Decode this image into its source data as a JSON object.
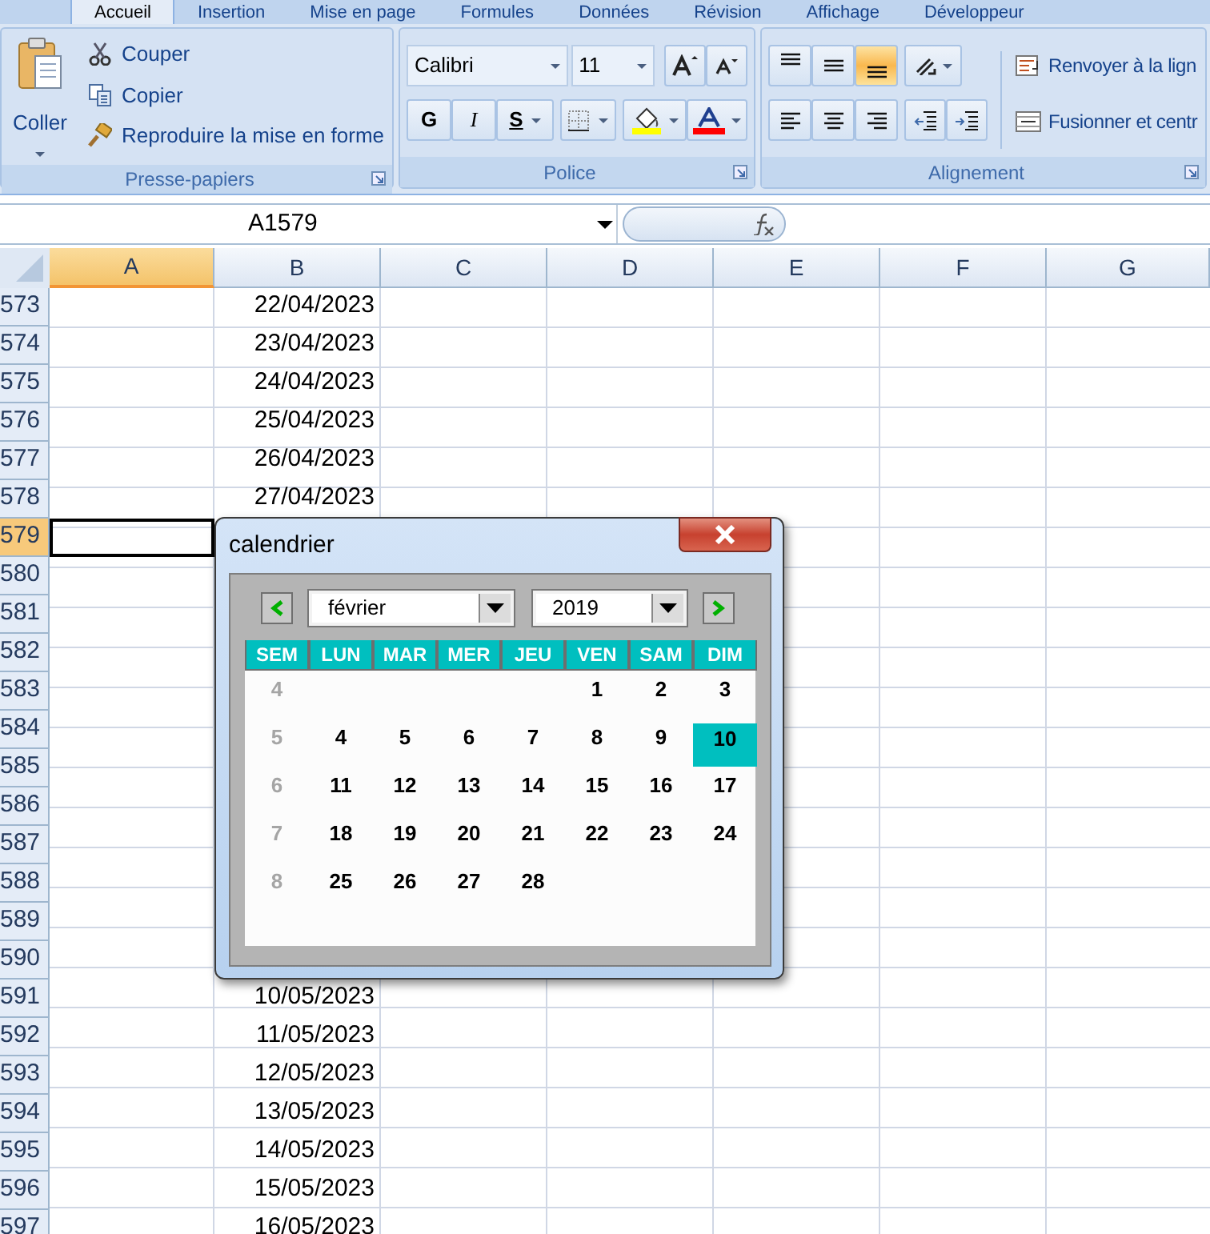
{
  "ribbon_tabs": [
    {
      "label": "Accueil",
      "selected": true
    },
    {
      "label": "Insertion",
      "selected": false
    },
    {
      "label": "Mise en page",
      "selected": false
    },
    {
      "label": "Formules",
      "selected": false
    },
    {
      "label": "Données",
      "selected": false
    },
    {
      "label": "Révision",
      "selected": false
    },
    {
      "label": "Affichage",
      "selected": false
    },
    {
      "label": "Développeur",
      "selected": false
    }
  ],
  "clipboard": {
    "paste": "Coller",
    "items": [
      {
        "kind": "cut",
        "label": "Couper"
      },
      {
        "kind": "copy",
        "label": "Copier"
      },
      {
        "kind": "format_painter",
        "label": "Reproduire la mise en forme"
      }
    ],
    "group_label": "Presse-papiers"
  },
  "font": {
    "name": "Calibri",
    "size": "11",
    "styles": [
      "G",
      "I",
      "S"
    ],
    "group_label": "Police"
  },
  "alignment": {
    "vertical": [
      {
        "kind": "top",
        "selected": false
      },
      {
        "kind": "middle",
        "selected": false
      },
      {
        "kind": "bottom",
        "selected": true
      }
    ],
    "horizontal": [
      {
        "kind": "left",
        "selected": false
      },
      {
        "kind": "center",
        "selected": false
      },
      {
        "kind": "right",
        "selected": false
      }
    ],
    "wrap_text": "Renvoyer à la lign",
    "merge": "Fusionner et centr",
    "group_label": "Alignement"
  },
  "name_box": "A1579",
  "columns": [
    {
      "label": "A",
      "selected": true
    },
    {
      "label": "B",
      "selected": false
    },
    {
      "label": "C",
      "selected": false
    },
    {
      "label": "D",
      "selected": false
    },
    {
      "label": "E",
      "selected": false
    },
    {
      "label": "F",
      "selected": false
    },
    {
      "label": "G",
      "selected": false
    }
  ],
  "rows": [
    {
      "number": "573",
      "selected": false,
      "column_b": "22/04/2023"
    },
    {
      "number": "574",
      "selected": false,
      "column_b": "23/04/2023"
    },
    {
      "number": "575",
      "selected": false,
      "column_b": "24/04/2023"
    },
    {
      "number": "576",
      "selected": false,
      "column_b": "25/04/2023"
    },
    {
      "number": "577",
      "selected": false,
      "column_b": "26/04/2023"
    },
    {
      "number": "578",
      "selected": false,
      "column_b": "27/04/2023"
    },
    {
      "number": "579",
      "selected": true
    },
    {
      "number": "580",
      "selected": false
    },
    {
      "number": "581",
      "selected": false
    },
    {
      "number": "582",
      "selected": false
    },
    {
      "number": "583",
      "selected": false
    },
    {
      "number": "584",
      "selected": false
    },
    {
      "number": "585",
      "selected": false
    },
    {
      "number": "586",
      "selected": false
    },
    {
      "number": "587",
      "selected": false
    },
    {
      "number": "588",
      "selected": false
    },
    {
      "number": "589",
      "selected": false
    },
    {
      "number": "590",
      "selected": false
    },
    {
      "number": "591",
      "selected": false,
      "column_b": "10/05/2023"
    },
    {
      "number": "592",
      "selected": false,
      "column_b": "11/05/2023"
    },
    {
      "number": "593",
      "selected": false,
      "column_b": "12/05/2023"
    },
    {
      "number": "594",
      "selected": false,
      "column_b": "13/05/2023"
    },
    {
      "number": "595",
      "selected": false,
      "column_b": "14/05/2023"
    },
    {
      "number": "596",
      "selected": false,
      "column_b": "15/05/2023"
    },
    {
      "number": "597",
      "selected": false,
      "column_b": "16/05/2023"
    }
  ],
  "dialog": {
    "title": "calendrier",
    "month": "février",
    "year": "2019",
    "weekday_headers": [
      "SEM",
      "LUN",
      "MAR",
      "MER",
      "JEU",
      "VEN",
      "SAM",
      "DIM"
    ],
    "weeks": [
      {
        "week": "4",
        "kind": "first",
        "days": [
          {
            "label": "1",
            "selected": false
          },
          {
            "label": "2",
            "selected": false
          },
          {
            "label": "3",
            "selected": false
          }
        ]
      },
      {
        "week": "5",
        "kind": "full",
        "days": [
          {
            "label": "4",
            "selected": false
          },
          {
            "label": "5",
            "selected": false
          },
          {
            "label": "6",
            "selected": false
          },
          {
            "label": "7",
            "selected": false
          },
          {
            "label": "8",
            "selected": false
          },
          {
            "label": "9",
            "selected": false
          },
          {
            "label": "10",
            "selected": true
          }
        ]
      },
      {
        "week": "6",
        "kind": "full",
        "days": [
          {
            "label": "11",
            "selected": false
          },
          {
            "label": "12",
            "selected": false
          },
          {
            "label": "13",
            "selected": false
          },
          {
            "label": "14",
            "selected": false
          },
          {
            "label": "15",
            "selected": false
          },
          {
            "label": "16",
            "selected": false
          },
          {
            "label": "17",
            "selected": false
          }
        ]
      },
      {
        "week": "7",
        "kind": "full",
        "days": [
          {
            "label": "18",
            "selected": false
          },
          {
            "label": "19",
            "selected": false
          },
          {
            "label": "20",
            "selected": false
          },
          {
            "label": "21",
            "selected": false
          },
          {
            "label": "22",
            "selected": false
          },
          {
            "label": "23",
            "selected": false
          },
          {
            "label": "24",
            "selected": false
          }
        ]
      },
      {
        "week": "8",
        "kind": "last",
        "days": [
          {
            "label": "25",
            "selected": false
          },
          {
            "label": "26",
            "selected": false
          },
          {
            "label": "27",
            "selected": false
          },
          {
            "label": "28",
            "selected": false
          }
        ]
      }
    ]
  }
}
